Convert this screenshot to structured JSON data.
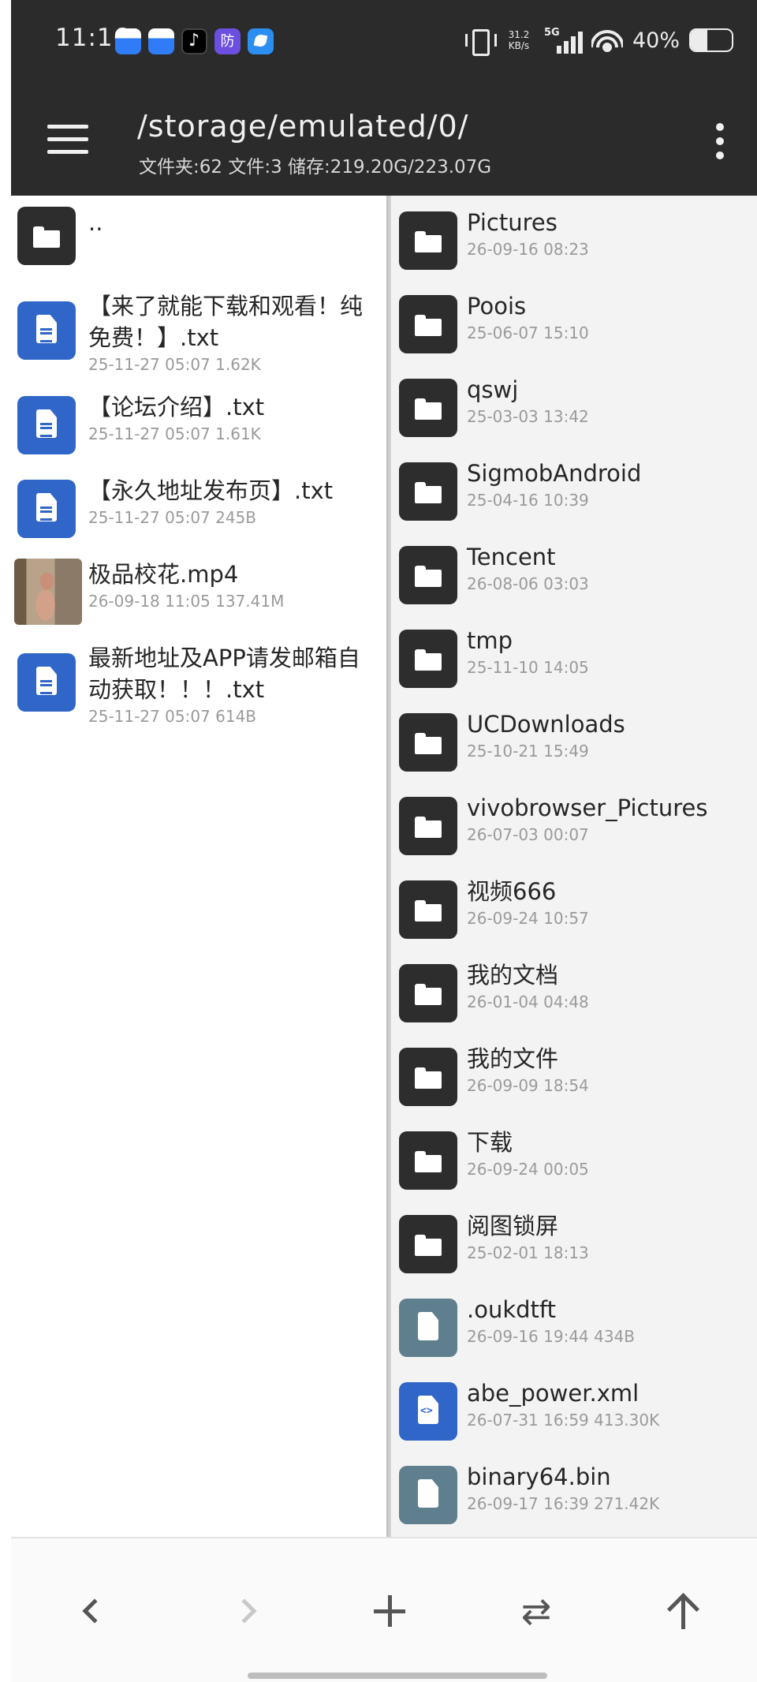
{
  "status_bar": {
    "time": "11:16",
    "net_speed_value": "31.2",
    "net_speed_unit": "KB/s",
    "network": "5G",
    "battery_text": "40%",
    "battery_level": 0.4
  },
  "toolbar": {
    "path": "/storage/emulated/0/",
    "info": "文件夹:62 文件:3 储存:219.20G/223.07G"
  },
  "left_pane": {
    "items": [
      {
        "type": "folder",
        "name": "..",
        "meta": ""
      },
      {
        "type": "text",
        "name": "【来了就能下载和观看！纯免费！】.txt",
        "meta": "25-11-27 05:07  1.62K"
      },
      {
        "type": "text",
        "name": "【论坛介绍】.txt",
        "meta": "25-11-27 05:07  1.61K"
      },
      {
        "type": "text",
        "name": "【永久地址发布页】.txt",
        "meta": "25-11-27 05:07  245B"
      },
      {
        "type": "video",
        "name": "极品校花.mp4",
        "meta": "26-09-18 11:05  137.41M"
      },
      {
        "type": "text",
        "name": "最新地址及APP请发邮箱自动获取！！！.txt",
        "meta": "25-11-27 05:07  614B"
      }
    ]
  },
  "right_pane": {
    "items": [
      {
        "type": "folder",
        "name": "Pictures",
        "meta": "26-09-16 08:23"
      },
      {
        "type": "folder",
        "name": "Poois",
        "meta": "25-06-07 15:10"
      },
      {
        "type": "folder",
        "name": "qswj",
        "meta": "25-03-03 13:42"
      },
      {
        "type": "folder",
        "name": "SigmobAndroid",
        "meta": "25-04-16 10:39"
      },
      {
        "type": "folder",
        "name": "Tencent",
        "meta": "26-08-06 03:03"
      },
      {
        "type": "folder",
        "name": "tmp",
        "meta": "25-11-10 14:05"
      },
      {
        "type": "folder",
        "name": "UCDownloads",
        "meta": "25-10-21 15:49"
      },
      {
        "type": "folder",
        "name": "vivobrowser_Pictures",
        "meta": "26-07-03 00:07"
      },
      {
        "type": "folder",
        "name": "视频666",
        "meta": "26-09-24 10:57"
      },
      {
        "type": "folder",
        "name": "我的文档",
        "meta": "26-01-04 04:48"
      },
      {
        "type": "folder",
        "name": "我的文件",
        "meta": "26-09-09 18:54"
      },
      {
        "type": "folder",
        "name": "下载",
        "meta": "26-09-24 00:05"
      },
      {
        "type": "folder",
        "name": "阅图锁屏",
        "meta": "25-02-01 18:13"
      },
      {
        "type": "file",
        "name": ".oukdtft",
        "meta": "26-09-16 19:44  434B"
      },
      {
        "type": "xml",
        "name": "abe_power.xml",
        "meta": "26-07-31 16:59  413.30K"
      },
      {
        "type": "file",
        "name": "binary64.bin",
        "meta": "26-09-17 16:39  271.42K"
      }
    ]
  },
  "bottom_bar": {
    "back_icon": "chevron-left-icon",
    "forward_icon": "chevron-right-icon",
    "new_icon": "plus-icon",
    "swap_icon": "swap-arrows-icon",
    "up_icon": "arrow-up-icon",
    "swap_glyph": "⇄"
  }
}
